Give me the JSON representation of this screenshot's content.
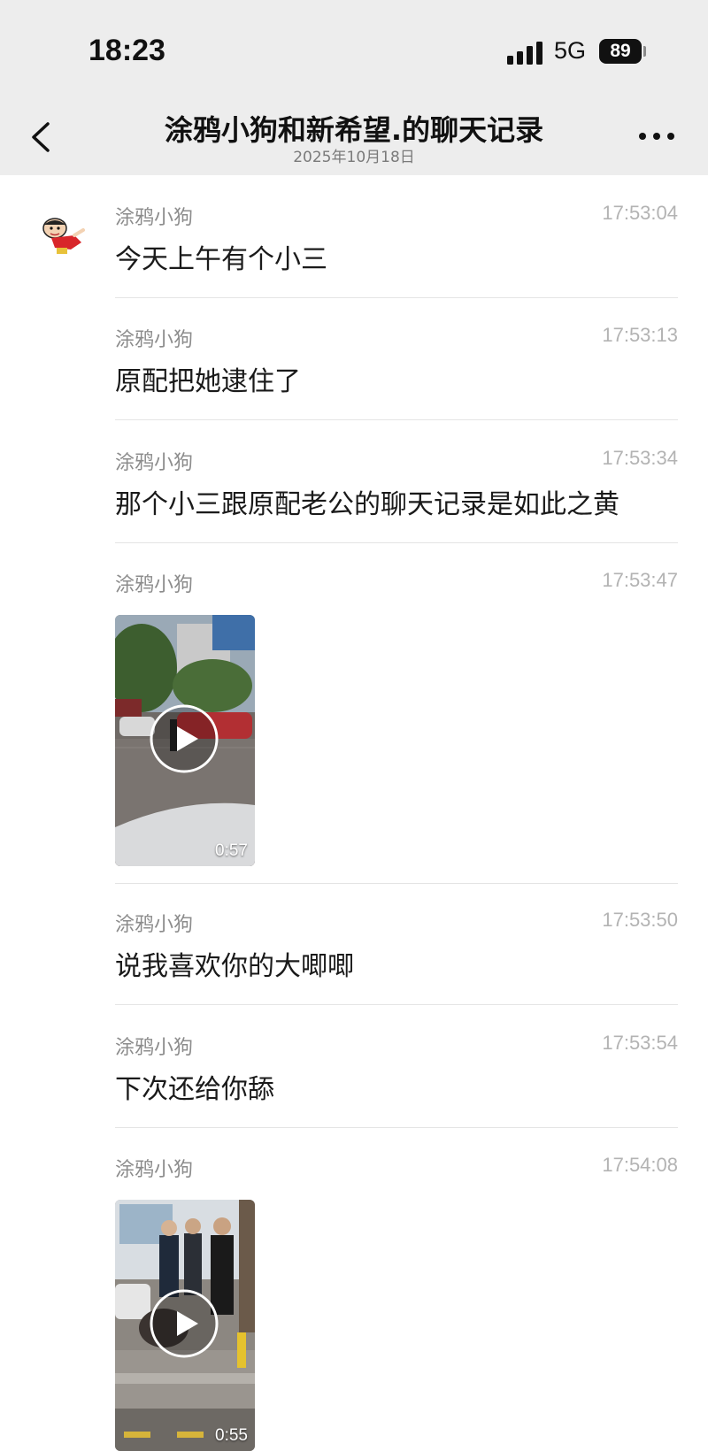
{
  "status_bar": {
    "time": "18:23",
    "network": "5G",
    "battery": "89",
    "icons": [
      "signal-icon",
      "battery-icon"
    ]
  },
  "nav": {
    "title": "涂鸦小狗和新希望.的聊天记录",
    "subtitle": "2025年10月18日",
    "icons": [
      "chevron-left-icon",
      "more-icon"
    ]
  },
  "messages": [
    {
      "sender": "涂鸦小狗",
      "time": "17:53:04",
      "text": "今天上午有个小三"
    },
    {
      "sender": "涂鸦小狗",
      "time": "17:53:13",
      "text": "原配把她逮住了"
    },
    {
      "sender": "涂鸦小狗",
      "time": "17:53:34",
      "text": "那个小三跟原配老公的聊天记录是如此之黄"
    },
    {
      "sender": "涂鸦小狗",
      "time": "17:53:47",
      "video_duration": "0:57"
    },
    {
      "sender": "涂鸦小狗",
      "time": "17:53:50",
      "text": "说我喜欢你的大唧唧"
    },
    {
      "sender": "涂鸦小狗",
      "time": "17:53:54",
      "text": "下次还给你舔"
    },
    {
      "sender": "涂鸦小狗",
      "time": "17:54:08",
      "video_duration": "0:55"
    }
  ],
  "colors": {
    "header_bg": "#ededed",
    "page_bg": "#ffffff",
    "sender": "#8c8c8c",
    "timestamp": "#b3b3b3",
    "divider": "#e4e4e4"
  }
}
